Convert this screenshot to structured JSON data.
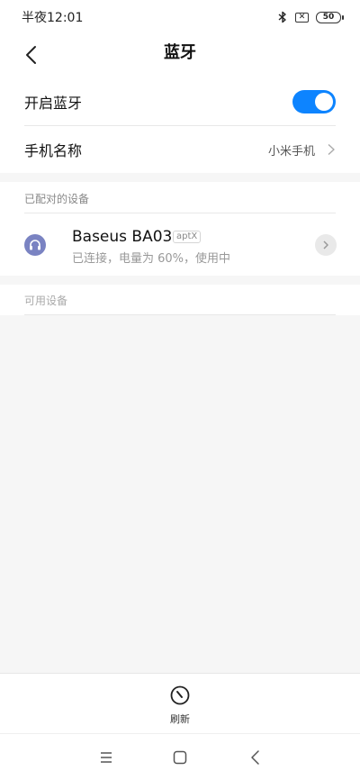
{
  "status_bar": {
    "time": "半夜12:01",
    "bluetooth_icon": "bluetooth-icon",
    "sim_icon": "no-sim-icon",
    "battery_level": "50"
  },
  "header": {
    "title": "蓝牙",
    "back_icon": "chevron-left-icon"
  },
  "settings": {
    "bluetooth_toggle": {
      "label": "开启蓝牙",
      "enabled": true
    },
    "device_name": {
      "label": "手机名称",
      "value": "小米手机"
    }
  },
  "paired_section": {
    "title": "已配对的设备",
    "devices": [
      {
        "name": "Baseus BA03",
        "badge": "aptX",
        "status": "已连接，电量为 60%，使用中",
        "icon": "headset-icon"
      }
    ]
  },
  "available_section": {
    "title": "可用设备"
  },
  "bottom_action": {
    "label": "刷新",
    "icon": "refresh-icon"
  },
  "nav_bar": {
    "icons": [
      "menu-icon",
      "home-icon",
      "back-icon"
    ]
  },
  "colors": {
    "accent": "#0d84ff",
    "device_icon": "#7a83c2"
  }
}
